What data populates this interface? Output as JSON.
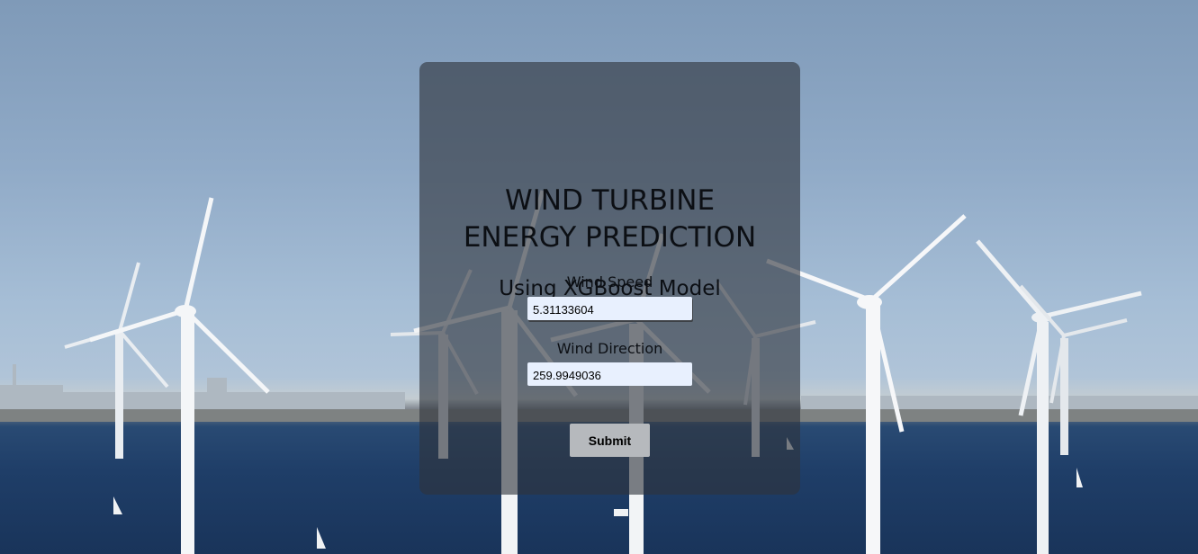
{
  "page": {
    "title_line1": "WIND TURBINE",
    "title_line2": "ENERGY PREDICTION",
    "subtitle": "Using XGBoost Model"
  },
  "form": {
    "wind_speed_label": "Wind Speed",
    "wind_speed_value": "5.31133604",
    "wind_direction_label": "Wind Direction",
    "wind_direction_value": "259.9949036",
    "submit_label": "Submit"
  },
  "background": {
    "sky_color": "#90aac7",
    "sea_color": "#1f3e68"
  }
}
